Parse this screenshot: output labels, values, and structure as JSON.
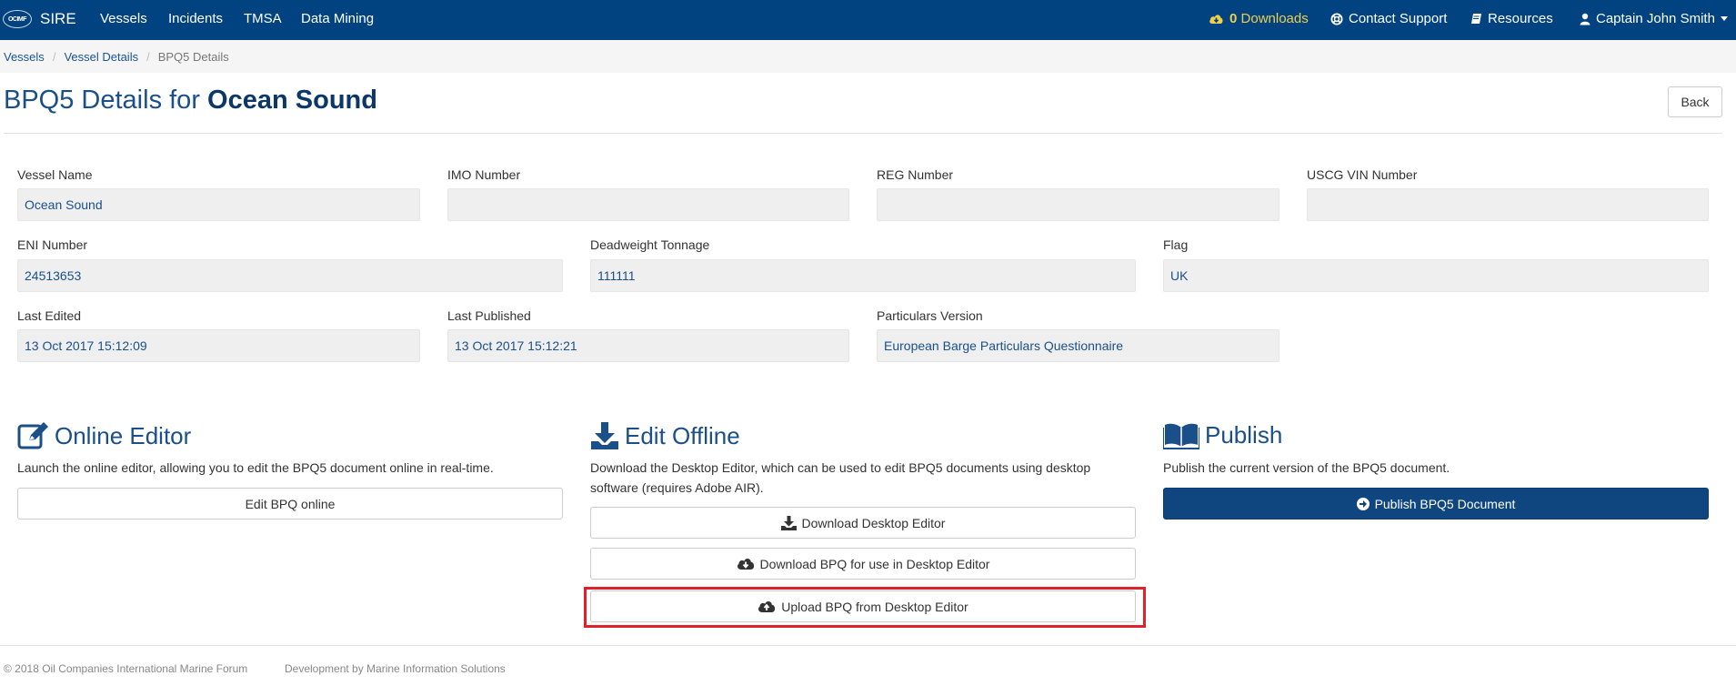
{
  "navbar": {
    "logo_text": "OCIMF",
    "brand": "SIRE",
    "links": [
      "Vessels",
      "Incidents",
      "TMSA",
      "Data Mining"
    ],
    "downloads_count": "0",
    "downloads_label": "Downloads",
    "contact_support": "Contact Support",
    "resources": "Resources",
    "user": "Captain John Smith",
    "downloads_color": "#f0d04a",
    "background_color": "#004380"
  },
  "breadcrumb": {
    "items": [
      "Vessels",
      "Vessel Details"
    ],
    "active": "BPQ5 Details"
  },
  "header": {
    "title_prefix": "BPQ5 Details for",
    "vessel_name": "Ocean Sound",
    "back_label": "Back"
  },
  "fields": {
    "vessel_name": {
      "label": "Vessel Name",
      "value": "Ocean Sound"
    },
    "imo_number": {
      "label": "IMO Number",
      "value": ""
    },
    "reg_number": {
      "label": "REG Number",
      "value": ""
    },
    "uscg_vin_number": {
      "label": "USCG VIN Number",
      "value": ""
    },
    "eni_number": {
      "label": "ENI Number",
      "value": "24513653"
    },
    "deadweight_tonnage": {
      "label": "Deadweight Tonnage",
      "value": "111111"
    },
    "flag": {
      "label": "Flag",
      "value": "UK"
    },
    "last_edited": {
      "label": "Last Edited",
      "value": "13 Oct 2017 15:12:09"
    },
    "last_published": {
      "label": "Last Published",
      "value": "13 Oct 2017 15:12:21"
    },
    "particulars_version": {
      "label": "Particulars Version",
      "value": "European Barge Particulars Questionnaire"
    }
  },
  "sections": {
    "online_editor": {
      "icon": "edit-icon",
      "title": "Online Editor",
      "description": "Launch the online editor, allowing you to edit the BPQ5 document online in real-time.",
      "button": "Edit BPQ online"
    },
    "edit_offline": {
      "icon": "download-tray-icon",
      "title": "Edit Offline",
      "description": "Download the Desktop Editor, which can be used to edit BPQ5 documents using desktop software (requires Adobe AIR).",
      "buttons": {
        "download_editor": "Download Desktop Editor",
        "download_bpq": "Download BPQ for use in Desktop Editor",
        "upload_bpq": "Upload BPQ from Desktop Editor"
      }
    },
    "publish": {
      "icon": "book-icon",
      "title": "Publish",
      "description": "Publish the current version of the BPQ5 document.",
      "button": "Publish BPQ5 Document",
      "button_color": "#0f4680"
    }
  },
  "highlight_color": "#e0202a",
  "footer": {
    "copyright": "© 2018 Oil Companies International Marine Forum",
    "developer": "Development by Marine Information Solutions"
  }
}
